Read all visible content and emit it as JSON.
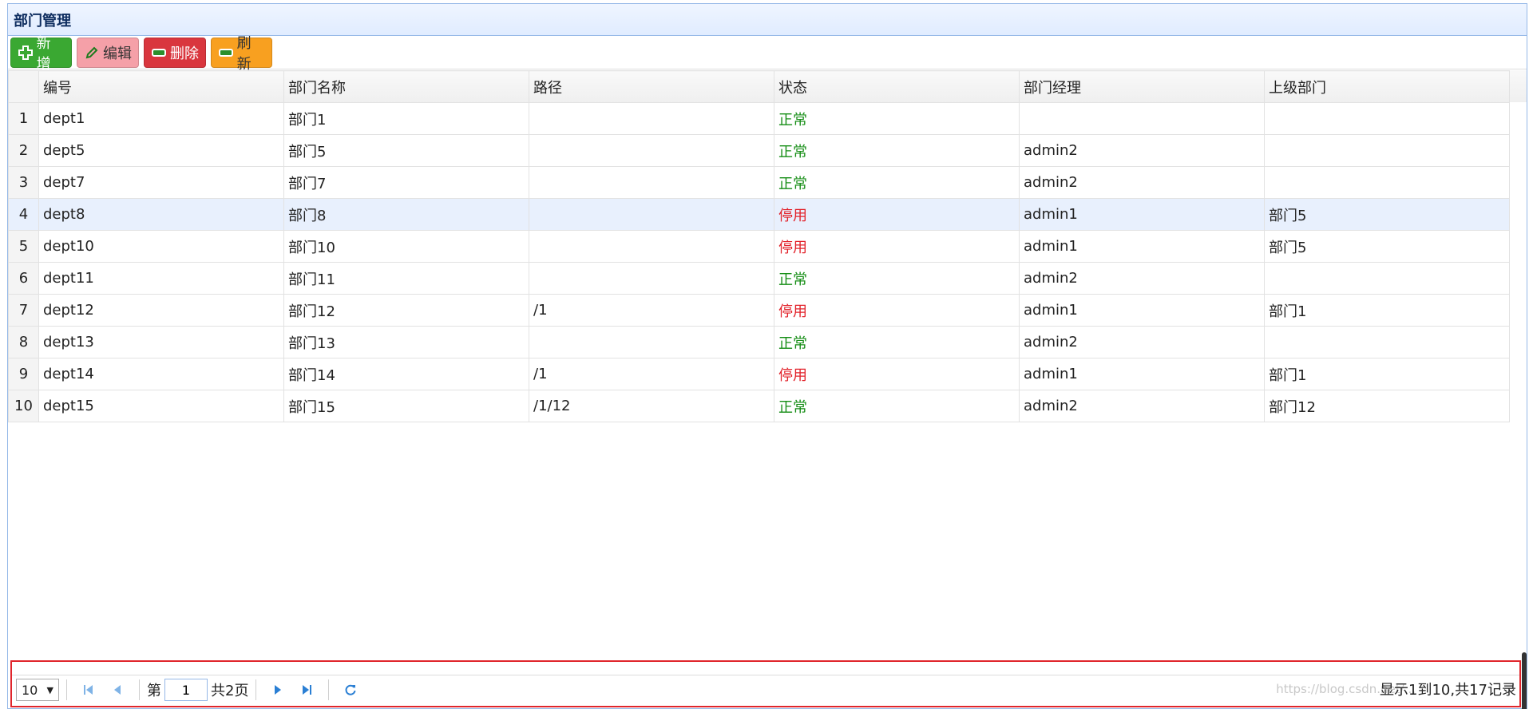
{
  "panel": {
    "title": "部门管理"
  },
  "toolbar": {
    "add_label": "新增",
    "edit_label": "编辑",
    "delete_label": "删除",
    "refresh_label": "刷新"
  },
  "table": {
    "columns": [
      "编号",
      "部门名称",
      "路径",
      "状态",
      "部门经理",
      "上级部门"
    ],
    "rows": [
      {
        "n": "1",
        "id": "dept1",
        "name": "部门1",
        "path": "",
        "status": "正常",
        "manager": "",
        "parent": ""
      },
      {
        "n": "2",
        "id": "dept5",
        "name": "部门5",
        "path": "",
        "status": "正常",
        "manager": "admin2",
        "parent": ""
      },
      {
        "n": "3",
        "id": "dept7",
        "name": "部门7",
        "path": "",
        "status": "正常",
        "manager": "admin2",
        "parent": ""
      },
      {
        "n": "4",
        "id": "dept8",
        "name": "部门8",
        "path": "",
        "status": "停用",
        "manager": "admin1",
        "parent": "部门5"
      },
      {
        "n": "5",
        "id": "dept10",
        "name": "部门10",
        "path": "",
        "status": "停用",
        "manager": "admin1",
        "parent": "部门5"
      },
      {
        "n": "6",
        "id": "dept11",
        "name": "部门11",
        "path": "",
        "status": "正常",
        "manager": "admin2",
        "parent": ""
      },
      {
        "n": "7",
        "id": "dept12",
        "name": "部门12",
        "path": "/1",
        "status": "停用",
        "manager": "admin1",
        "parent": "部门1"
      },
      {
        "n": "8",
        "id": "dept13",
        "name": "部门13",
        "path": "",
        "status": "正常",
        "manager": "admin2",
        "parent": ""
      },
      {
        "n": "9",
        "id": "dept14",
        "name": "部门14",
        "path": "/1",
        "status": "停用",
        "manager": "admin1",
        "parent": "部门1"
      },
      {
        "n": "10",
        "id": "dept15",
        "name": "部门15",
        "path": "/1/12",
        "status": "正常",
        "manager": "admin2",
        "parent": "部门12"
      }
    ],
    "selected_row": 3
  },
  "status_colors": {
    "正常": "#168e16",
    "停用": "#e2222a"
  },
  "pager": {
    "page_size": "10",
    "page_prefix": "第",
    "current_page": "1",
    "page_suffix": "共2页",
    "info": "显示1到10,共17记录",
    "watermark": "https://blog.csdn.net/..."
  },
  "icons": {
    "add": "plus-icon",
    "edit": "pencil-icon",
    "delete": "minus-icon",
    "refresh": "minus-icon",
    "first": "first-page-icon",
    "prev": "prev-page-icon",
    "next": "next-page-icon",
    "last": "last-page-icon",
    "reload": "reload-icon"
  }
}
